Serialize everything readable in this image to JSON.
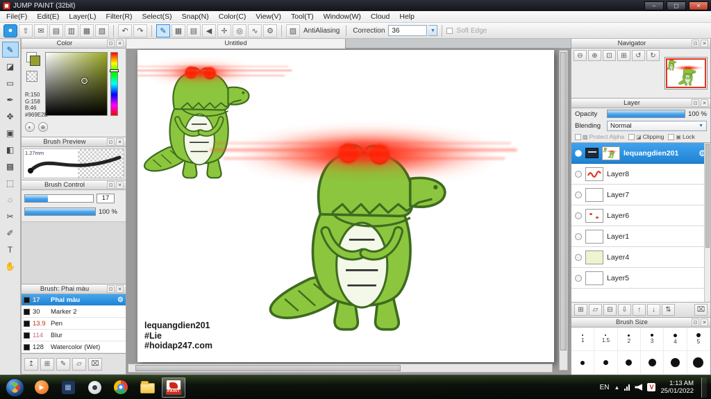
{
  "window": {
    "title": "JUMP PAINT (32bit)",
    "menu": [
      "File(F)",
      "Edit(E)",
      "Layer(L)",
      "Filter(R)",
      "Select(S)",
      "Snap(N)",
      "Color(C)",
      "View(V)",
      "Tool(T)",
      "Window(W)",
      "Cloud",
      "Help"
    ]
  },
  "toolbar": {
    "antialiasing": "AntiAliasing",
    "correction": "Correction",
    "correction_value": "36",
    "soft_edge": "Soft Edge"
  },
  "panels": {
    "color": {
      "title": "Color",
      "r": "R:150",
      "g": "G:158",
      "b": "B:46",
      "hex": "#969E2E"
    },
    "brush_preview": {
      "title": "Brush Preview",
      "size_label": "1.27mm"
    },
    "brush_control": {
      "title": "Brush Control",
      "size_value": "17",
      "opacity_value": "100 %"
    },
    "brush_list": {
      "title": "Brush: Phai màu",
      "items": [
        {
          "size": "17",
          "name": "Phai màu"
        },
        {
          "size": "30",
          "name": "Marker 2"
        },
        {
          "size": "13.9",
          "name": "Pen"
        },
        {
          "size": "114",
          "name": "Blur"
        },
        {
          "size": "128",
          "name": "Watercolor (Wet)"
        }
      ]
    },
    "navigator": {
      "title": "Navigator"
    },
    "layer": {
      "title": "Layer",
      "opacity_label": "Opacity",
      "opacity_value": "100 %",
      "blending_label": "Blending",
      "blending_value": "Normal",
      "protect_alpha": "Protect Alpha",
      "clipping": "Clipping",
      "lock": "Lock",
      "layers": [
        {
          "name": "lequangdien201"
        },
        {
          "name": "Layer8"
        },
        {
          "name": "Layer7"
        },
        {
          "name": "Layer6"
        },
        {
          "name": "Layer1"
        },
        {
          "name": "Layer4"
        },
        {
          "name": "Layer5"
        }
      ]
    },
    "brush_size": {
      "title": "Brush Size",
      "labels": [
        "1",
        "1.5",
        "2",
        "3",
        "4",
        "5"
      ]
    }
  },
  "canvas": {
    "tab": "Untitled",
    "signature": [
      "lequangdien201",
      "#Lie",
      "#hoidap247.com"
    ]
  },
  "taskbar": {
    "lang": "EN",
    "app_label": "PAINT",
    "tray_badge": "V",
    "time": "1:13 AM",
    "date": "25/01/2022"
  },
  "colors": {
    "selection_blue": "#2f9be8",
    "picked_color": "#969E2E",
    "croc_green": "#8cc63e",
    "glow_red": "#ff2400"
  }
}
